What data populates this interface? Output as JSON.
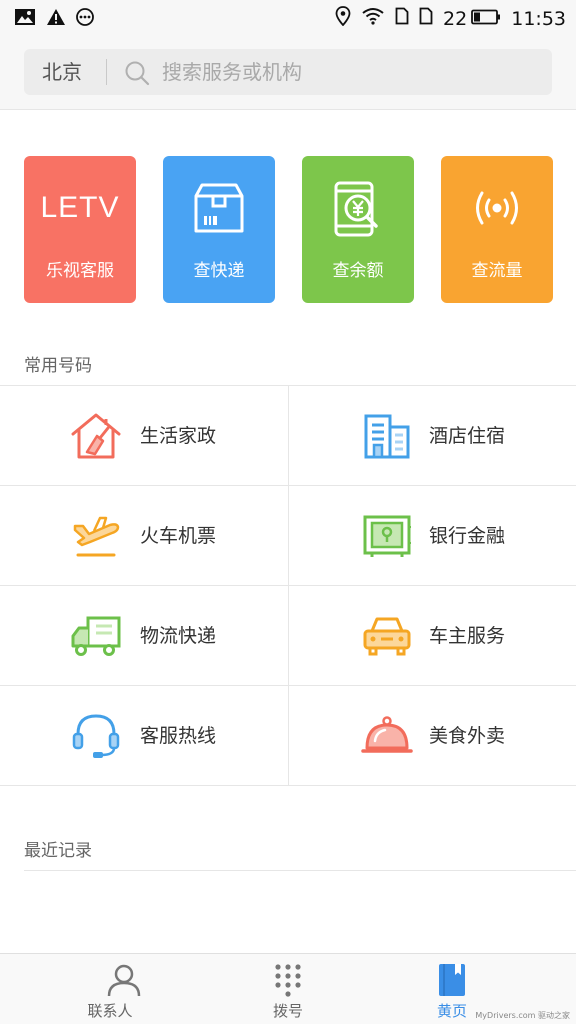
{
  "status_bar": {
    "left_icons": [
      "image-icon",
      "warning-icon",
      "more-icon"
    ],
    "right_icons": [
      "location-icon",
      "wifi-icon",
      "sim1-icon",
      "sim2-icon"
    ],
    "battery": "22",
    "time": "11:53"
  },
  "header": {
    "city": "北京",
    "search_placeholder": "搜索服务或机构"
  },
  "shortcuts": [
    {
      "logo_text": "LETV",
      "label": "乐视客服",
      "icon": "letv-logo",
      "color": "#f87264"
    },
    {
      "label": "查快递",
      "icon": "package-icon",
      "color": "#49a3f3"
    },
    {
      "label": "查余额",
      "icon": "phone-yuan-icon",
      "color": "#7dc64b"
    },
    {
      "label": "查流量",
      "icon": "signal-icon",
      "color": "#f9a431"
    }
  ],
  "common_numbers": {
    "title": "常用号码",
    "items": [
      {
        "label": "生活家政",
        "icon": "house-broom-icon",
        "color": "#f26c5b"
      },
      {
        "label": "酒店住宿",
        "icon": "hotel-building-icon",
        "color": "#43a0e8"
      },
      {
        "label": "火车机票",
        "icon": "airplane-icon",
        "color": "#f5a623"
      },
      {
        "label": "银行金融",
        "icon": "bank-safe-icon",
        "color": "#6cc04a"
      },
      {
        "label": "物流快递",
        "icon": "truck-icon",
        "color": "#6cc04a"
      },
      {
        "label": "车主服务",
        "icon": "car-icon",
        "color": "#f5a623"
      },
      {
        "label": "客服热线",
        "icon": "headset-icon",
        "color": "#43a0e8"
      },
      {
        "label": "美食外卖",
        "icon": "food-cloche-icon",
        "color": "#f26c5b"
      }
    ]
  },
  "recent": {
    "title": "最近记录"
  },
  "bottom_nav": [
    {
      "label": "联系人",
      "icon": "person-icon",
      "active": false
    },
    {
      "label": "拨号",
      "icon": "dialpad-icon",
      "active": false
    },
    {
      "label": "黄页",
      "icon": "book-icon",
      "active": true
    }
  ],
  "watermark": "MyDrivers.com 驱动之家"
}
